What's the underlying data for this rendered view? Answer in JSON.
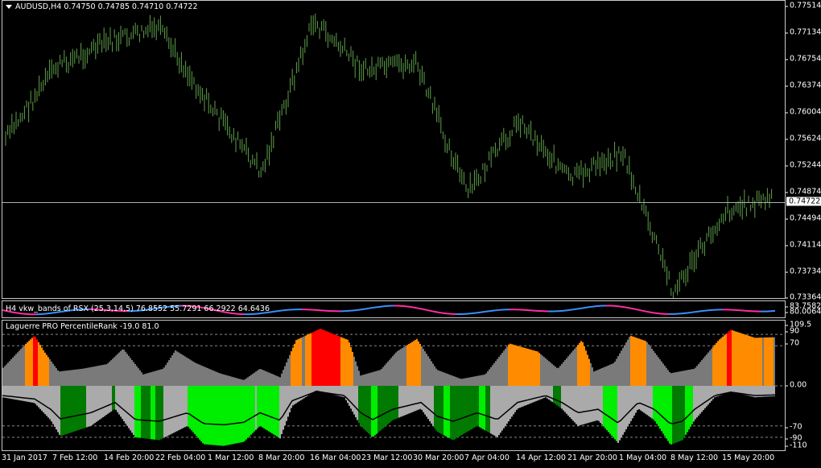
{
  "main": {
    "symbol_label": "AUDUSD,H4",
    "ohlc": "0.74750 0.74785 0.74710 0.74722",
    "last_price": "0.74722",
    "y_ticks": [
      "0.77514",
      "0.77134",
      "0.76754",
      "0.76374",
      "0.76004",
      "0.75624",
      "0.75244",
      "0.74874",
      "0.74494",
      "0.74114",
      "0.73734",
      "0.73364"
    ]
  },
  "rsx": {
    "label": "H4 vkw_bands of RSX (25,3,14,5) 76.8552 55.7291 66.2922 64.6436",
    "y_ticks": [
      "83.7582",
      "80.0064"
    ],
    "colors": {
      "up": "#3a8fff",
      "down": "#ff2ea6"
    }
  },
  "laguerre": {
    "label": "Laguerre PRO PercentileRank -19.0 81.0",
    "y_ticks": [
      "109.5",
      "90",
      "70",
      "0.00",
      "-70",
      "-90",
      "-110"
    ],
    "colors": {
      "grey": "#7a7a7a",
      "lightgrey": "#aaaaaa",
      "orange": "#ff8c00",
      "red": "#ff0000",
      "darkgreen": "#007a00",
      "green": "#00ee00"
    }
  },
  "x_ticks": [
    "31 Jan 2017",
    "7 Feb 12:00",
    "14 Feb 20:00",
    "22 Feb 04:00",
    "1 Mar 12:00",
    "8 Mar 20:00",
    "16 Mar 04:00",
    "23 Mar 12:00",
    "30 Mar 20:00",
    "7 Apr 04:00",
    "14 Apr 12:00",
    "21 Apr 20:00",
    "1 May 04:00",
    "8 May 12:00",
    "15 May 20:00"
  ],
  "chart_data": {
    "type": "line",
    "title": "AUDUSD,H4",
    "ylim": [
      0.73364,
      0.77514
    ],
    "x": [
      "31 Jan 2017",
      "7 Feb 12:00",
      "14 Feb 20:00",
      "22 Feb 04:00",
      "1 Mar 12:00",
      "8 Mar 20:00",
      "16 Mar 04:00",
      "23 Mar 12:00",
      "30 Mar 20:00",
      "7 Apr 04:00",
      "14 Apr 12:00",
      "21 Apr 20:00",
      "1 May 04:00",
      "8 May 12:00",
      "15 May 20:00"
    ],
    "series": [
      {
        "name": "AUDUSD,H4",
        "values": [
          0.756,
          0.7665,
          0.77,
          0.772,
          0.761,
          0.7515,
          0.773,
          0.766,
          0.767,
          0.7485,
          0.759,
          0.7505,
          0.7545,
          0.7345,
          0.746
        ]
      }
    ]
  }
}
